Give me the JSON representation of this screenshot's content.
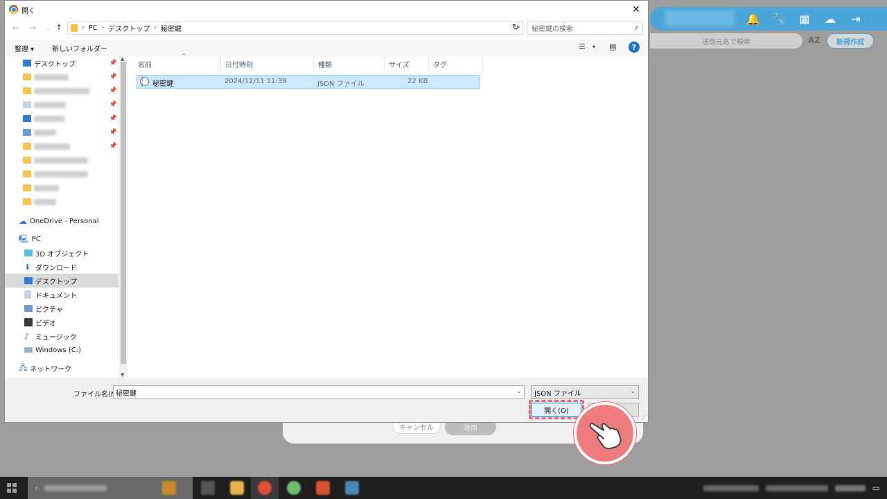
{
  "background_app": {
    "search_placeholder": "送信元名で検索",
    "sort_label": "AZ",
    "new_button": "新規作成",
    "cancel_button": "キャンセル",
    "apply_button": "適用",
    "header_icons": [
      "bell-icon",
      "wrench-icon",
      "grid-icon",
      "cloud-chat-icon",
      "sign-in-icon"
    ]
  },
  "dialog": {
    "title": "開く",
    "breadcrumb": [
      "PC",
      "デスクトップ",
      "秘密鍵"
    ],
    "search_placeholder": "秘密鍵の検索",
    "toolbar": {
      "organize": "整理 ▾",
      "new_folder": "新しいフォルダー"
    },
    "nav": {
      "quick_access_first": "デスクトップ",
      "onedrive": "OneDrive - Personal",
      "pc": "PC",
      "pc_items": [
        "3D オブジェクト",
        "ダウンロード",
        "デスクトップ",
        "ドキュメント",
        "ピクチャ",
        "ビデオ",
        "ミュージック",
        "Windows (C:)"
      ],
      "network": "ネットワーク"
    },
    "columns": [
      "名前",
      "日付時刻",
      "種類",
      "サイズ",
      "タグ"
    ],
    "files": [
      {
        "name": "秘密鍵",
        "date": "2024/12/11 11:39",
        "type": "JSON ファイル",
        "size": "22 KB"
      }
    ],
    "filename_label": "ファイル名(N):",
    "filename_value": "秘密鍵",
    "filetype_value": "JSON ファイル",
    "open_button": "開く(O)"
  },
  "colors": {
    "accent": "#0078d7",
    "highlight": "#e96b6f",
    "selection": "#cce8ff",
    "app_blue": "#4aa6d8"
  }
}
